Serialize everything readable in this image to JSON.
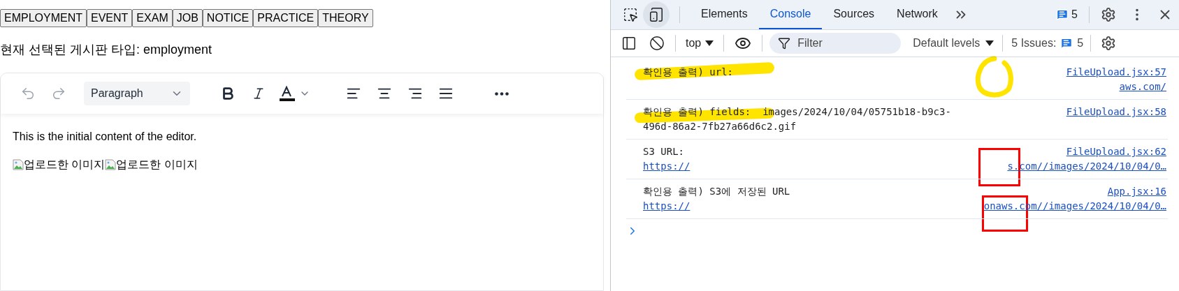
{
  "board_types": [
    {
      "label": "EMPLOYMENT"
    },
    {
      "label": "EVENT"
    },
    {
      "label": "EXAM"
    },
    {
      "label": "JOB"
    },
    {
      "label": "NOTICE"
    },
    {
      "label": "PRACTICE"
    },
    {
      "label": "THEORY"
    }
  ],
  "current_type": {
    "label": "현재 선택된 게시판 타입:",
    "value": "employment"
  },
  "editor": {
    "history": [
      {
        "kind": "undo",
        "disabled": true
      },
      {
        "kind": "redo",
        "disabled": true
      }
    ],
    "block_style": "Paragraph",
    "content": "This is the initial content of the editor.",
    "images": [
      {
        "alt": "업로드한 이미지"
      },
      {
        "alt": "업로드한 이미지"
      }
    ]
  },
  "devtools": {
    "device_toolbar_on": true,
    "tabs": [
      {
        "label": "Elements",
        "selected": false
      },
      {
        "label": "Console",
        "selected": true
      },
      {
        "label": "Sources",
        "selected": false
      },
      {
        "label": "Network",
        "selected": false
      }
    ],
    "message_count": "5",
    "context": "top",
    "filter_placeholder": "Filter",
    "levels": "Default levels",
    "issues_label": "5 Issues:",
    "issues_count": "5",
    "messages": [
      {
        "text": "확인용 출력) url:",
        "source": "FileUpload.jsx:57",
        "link_right": "aws.com/"
      },
      {
        "text": "확인용 출력) fields:  images/2024/10/04/05751b18-b9c3-496d-86a2-7fb27a66d6c2.gif",
        "source": "FileUpload.jsx:58"
      },
      {
        "text": "S3 URL:",
        "source": "FileUpload.jsx:62",
        "link_left": "https://",
        "link_right": "s.com//images/2024/10/04/0…"
      },
      {
        "text": "확인용 출력) S3에 저장된 URL",
        "source": "App.jsx:16",
        "link_left": "https://",
        "link_right": "onaws.com//images/2024/10/04/0…"
      }
    ]
  },
  "annotations": [
    {
      "kind": "highlight",
      "color": "#ffe400"
    },
    {
      "kind": "highlight",
      "color": "#ffe400"
    },
    {
      "kind": "circle",
      "color": "#ffe400"
    },
    {
      "kind": "box",
      "color": "#ff0000"
    },
    {
      "kind": "box",
      "color": "#ff0000"
    }
  ]
}
